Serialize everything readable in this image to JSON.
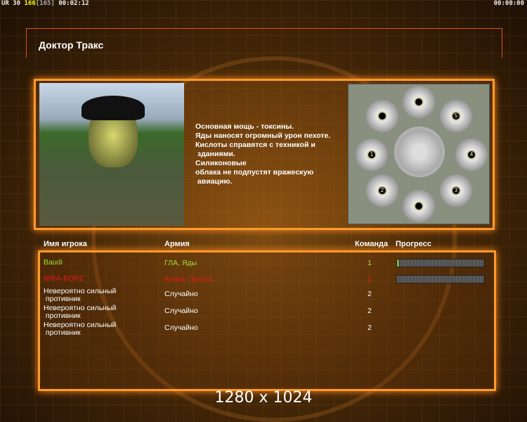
{
  "hud": {
    "left_ur": "UR",
    "left_a": "30",
    "left_b": "166",
    "left_c": "[165]",
    "left_time": "00:02:12",
    "right_time": "00:00:00"
  },
  "title": "Доктор Тракс",
  "description": "Основная мощь - токсины.\nЯды наносят огромный урон пехоте.\nКислоты справятся с техникой и\n зданиями.\nСиликоновые\nоблака не подпустят вражескую\n авиацию.",
  "map": {
    "spots": [
      "1",
      "2",
      "3",
      "4",
      "5",
      "",
      "",
      ""
    ]
  },
  "columns": {
    "name": "Имя игрока",
    "army": "Армия",
    "team": "Команда",
    "progress": "Прогресс"
  },
  "players": [
    {
      "name": "Baudi",
      "army": "ГЛА, Яды",
      "team": "1",
      "progress": 0.01,
      "color": "#9be032"
    },
    {
      "name": "IBRA-BORZ",
      "army": "Китай, Пехота",
      "team": "1",
      "progress": 0,
      "color": "#e81818"
    },
    {
      "name": "Невероятно сильный\n противник",
      "army": "Случайно",
      "team": "2",
      "color": "#ffffff"
    },
    {
      "name": "Невероятно сильный\n противник",
      "army": "Случайно",
      "team": "2",
      "color": "#ffffff"
    },
    {
      "name": "Невероятно сильный\n противник",
      "army": "Случайно",
      "team": "2",
      "color": "#ffffff"
    }
  ],
  "resolution": "1280 x 1024"
}
